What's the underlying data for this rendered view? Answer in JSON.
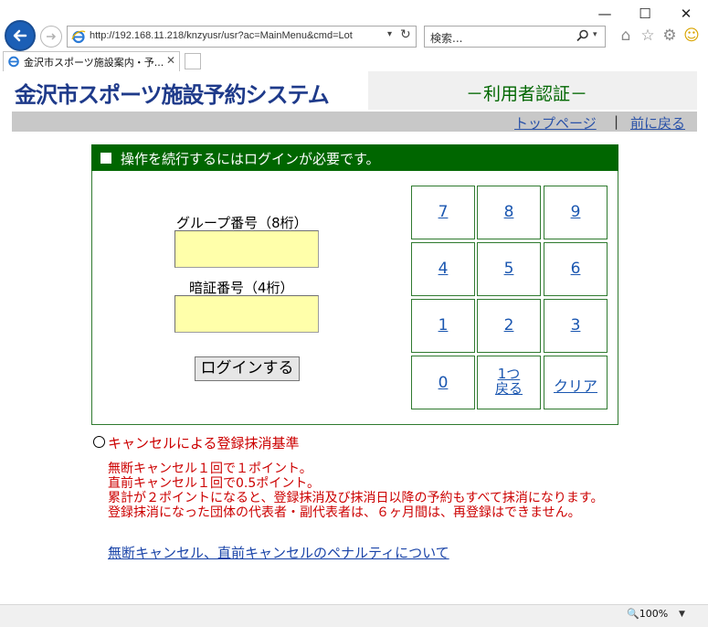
{
  "browser": {
    "url": "http://192.168.11.218/knzyusr/usr?ac=MainMenu&cmd=Lot",
    "search_placeholder": "検索...",
    "tab_title": "金沢市スポーツ施設案内・予...",
    "zoom": "100%"
  },
  "window_controls": {
    "minimize": "—",
    "maximize": "☐",
    "close": "✕"
  },
  "header": {
    "logo": "金沢市スポーツ施設予約システム",
    "subtitle": "－利用者認証－",
    "links": {
      "top_page": "トップページ",
      "separator": "|",
      "back": "前に戻る"
    }
  },
  "login": {
    "panel_title": "操作を続行するにはログインが必要です。",
    "group_label": "グループ番号（8桁）",
    "group_value": "",
    "pin_label": "暗証番号（4桁）",
    "pin_value": "",
    "login_button": "ログインする"
  },
  "keypad": {
    "rows": [
      [
        "7",
        "8",
        "9"
      ],
      [
        "4",
        "5",
        "6"
      ],
      [
        "1",
        "2",
        "3"
      ]
    ],
    "zero": "0",
    "back_line1": "1つ",
    "back_line2": "戻る",
    "clear": "クリア"
  },
  "cancel": {
    "heading": "キャンセルによる登録抹消基準",
    "rules": [
      "無断キャンセル１回で１ポイント。",
      "直前キャンセル１回で0.5ポイント。",
      "累計が２ポイントになると、登録抹消及び抹消日以降の予約もすべて抹消になります。登録抹消になった団体の代表者・副代表者は、６ヶ月間は、再登録はできません。"
    ],
    "penalty_link": "無断キャンセル、直前キャンセルのペナルティについて"
  },
  "colors": {
    "accent_green": "#006600",
    "logo_blue": "#1e3a8a",
    "link_blue": "#1a56b0",
    "notice_red": "#cc0000",
    "input_yellow": "#ffffaa"
  }
}
